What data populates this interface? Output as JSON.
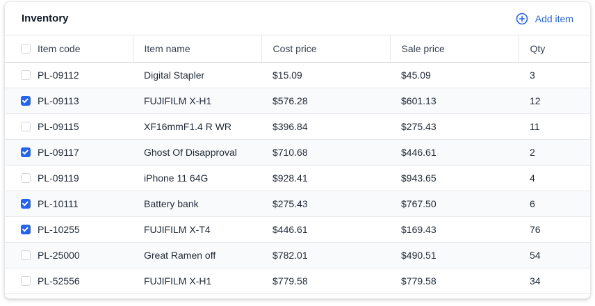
{
  "header": {
    "title": "Inventory",
    "add_label": "Add item",
    "add_icon": "plus-circle-icon"
  },
  "columns": [
    "Item code",
    "Item name",
    "Cost price",
    "Sale price",
    "Qty"
  ],
  "rows": [
    {
      "checked": false,
      "code": "PL-09112",
      "name": "Digital Stapler",
      "cost": "$15.09",
      "sale": "$45.09",
      "qty": "3"
    },
    {
      "checked": true,
      "code": "PL-09113",
      "name": "FUJIFILM X-H1",
      "cost": "$576.28",
      "sale": "$601.13",
      "qty": "12"
    },
    {
      "checked": false,
      "code": "PL-09115",
      "name": "XF16mmF1.4 R WR",
      "cost": "$396.84",
      "sale": "$275.43",
      "qty": "11"
    },
    {
      "checked": true,
      "code": "PL-09117",
      "name": "Ghost Of Disapproval",
      "cost": "$710.68",
      "sale": "$446.61",
      "qty": "2"
    },
    {
      "checked": false,
      "code": "PL-09119",
      "name": "iPhone 11 64G",
      "cost": "$928.41",
      "sale": "$943.65",
      "qty": "4"
    },
    {
      "checked": true,
      "code": "PL-10111",
      "name": "Battery bank",
      "cost": "$275.43",
      "sale": "$767.50",
      "qty": "6"
    },
    {
      "checked": true,
      "code": "PL-10255",
      "name": "FUJIFILM X-T4",
      "cost": "$446.61",
      "sale": "$169.43",
      "qty": "76"
    },
    {
      "checked": false,
      "code": "PL-25000",
      "name": "Great Ramen off",
      "cost": "$782.01",
      "sale": "$490.51",
      "qty": "54"
    },
    {
      "checked": false,
      "code": "PL-52556",
      "name": "FUJIFILM X-H1",
      "cost": "$779.58",
      "sale": "$779.58",
      "qty": "34"
    }
  ],
  "colors": {
    "accent": "#2563eb",
    "row_alt": "#f9fafb",
    "border": "#e5e7eb"
  }
}
